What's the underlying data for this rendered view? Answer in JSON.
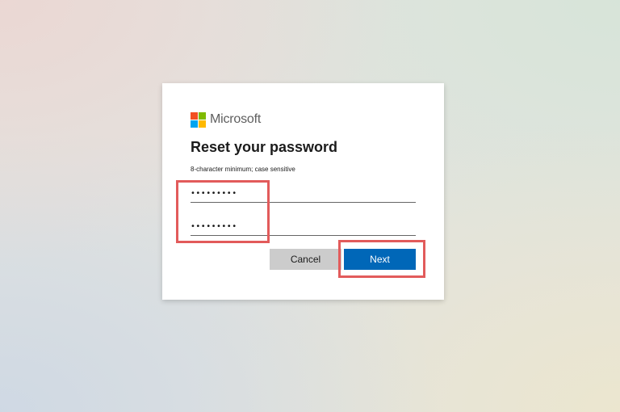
{
  "brand": {
    "name": "Microsoft",
    "logo_icon": "microsoft-logo-icon",
    "logo_colors": [
      "#f25022",
      "#7fba00",
      "#00a4ef",
      "#ffb900"
    ]
  },
  "dialog": {
    "title": "Reset your password",
    "hint": "8-character minimum; case sensitive",
    "new_password_value": "•••••••••",
    "confirm_password_value": "•••••••••"
  },
  "actions": {
    "cancel_label": "Cancel",
    "next_label": "Next"
  },
  "colors": {
    "primary": "#0067b8",
    "secondary_button": "#cccccc",
    "highlight": "#e25b5b"
  }
}
